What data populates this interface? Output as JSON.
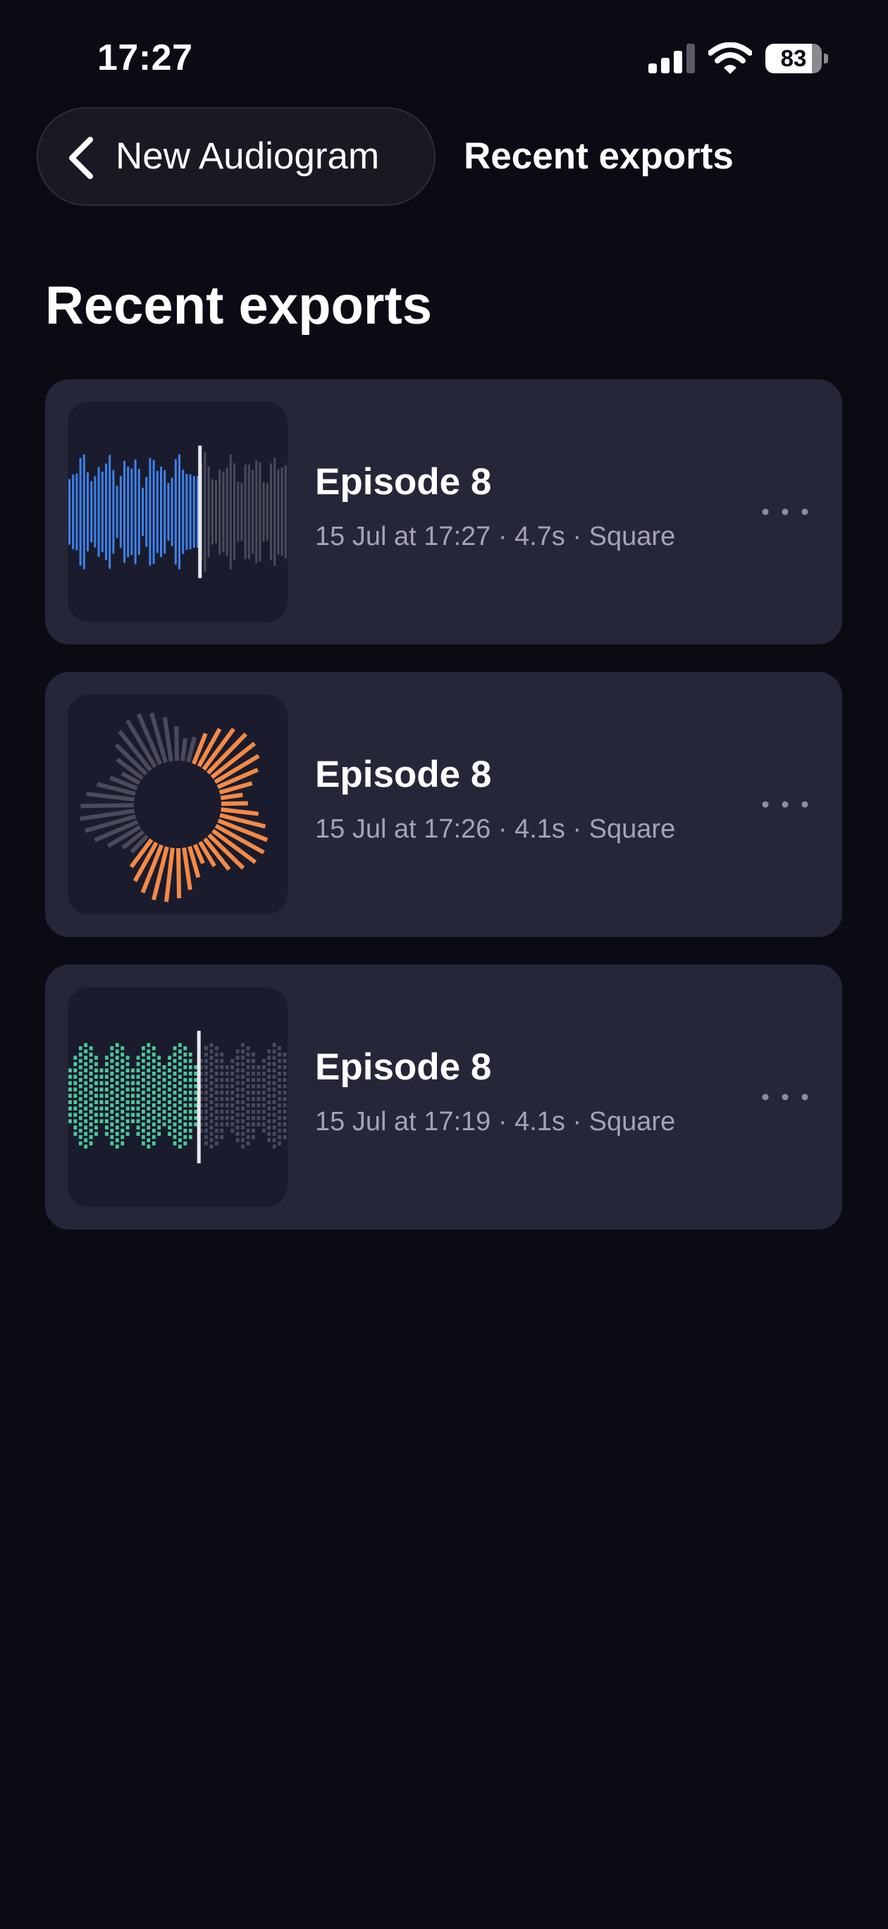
{
  "status_bar": {
    "time": "17:27",
    "battery_level": "83",
    "battery_fraction": 0.83,
    "icons": [
      "signal-icon",
      "wifi-icon",
      "battery-icon"
    ]
  },
  "nav": {
    "back_label": "New Audiogram",
    "title": "Recent exports",
    "back_icon": "chevron-left-icon"
  },
  "page": {
    "title": "Recent exports"
  },
  "colors": {
    "background": "#0b0b14",
    "card": "#262639",
    "thumb_background": "#1a1c2e",
    "accent_blue": "#3f82ea",
    "accent_orange": "#f48a45",
    "accent_green": "#4cc99a",
    "muted_bars": "#4a4a5a",
    "meta_text": "#a4a4b4"
  },
  "exports": [
    {
      "title": "Episode 8",
      "meta": "15 Jul at 17:27 · 4.7s · Square",
      "style": "waveform",
      "accent": "#3f82ea",
      "progress": 0.6
    },
    {
      "title": "Episode 8",
      "meta": "15 Jul at 17:26 · 4.1s · Square",
      "style": "radial",
      "accent": "#f48a45",
      "progress": 0.55
    },
    {
      "title": "Episode 8",
      "meta": "15 Jul at 17:19 · 4.1s · Square",
      "style": "segmented-bars",
      "accent": "#4cc99a",
      "progress": 0.6
    }
  ]
}
